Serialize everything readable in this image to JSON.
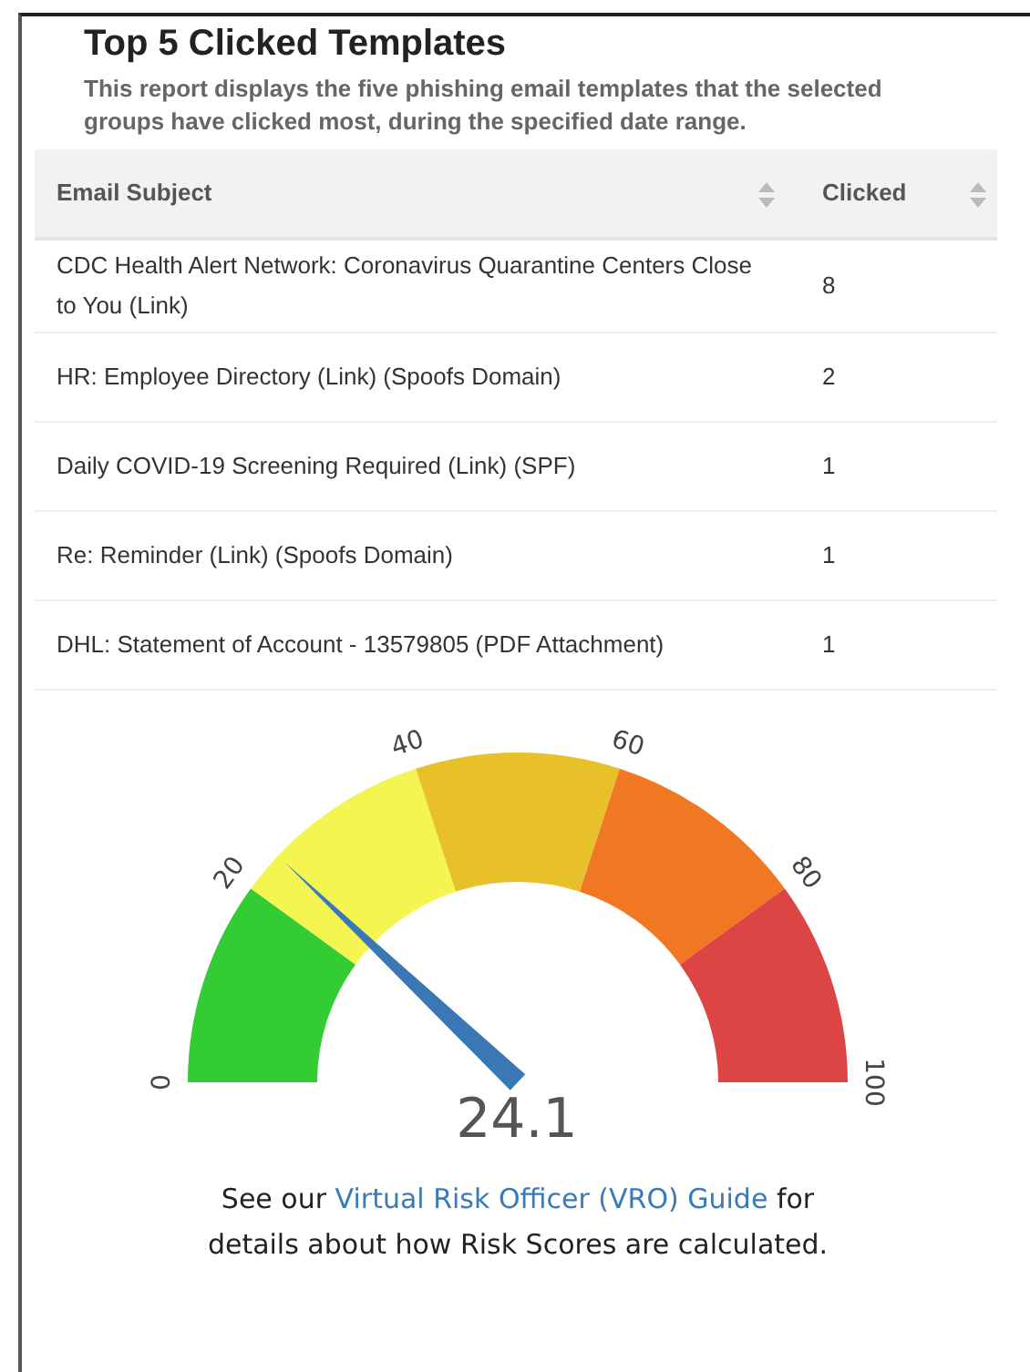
{
  "report": {
    "title": "Top 5 Clicked Templates",
    "description": "This report displays the five phishing email templates that the selected groups have clicked most, during the specified date range."
  },
  "table": {
    "columns": [
      {
        "label": "Email Subject"
      },
      {
        "label": "Clicked"
      }
    ],
    "rows": [
      {
        "subject": "CDC Health Alert Network: Coronavirus Quarantine Centers Close to You (Link)",
        "clicked": "8"
      },
      {
        "subject": "HR: Employee Directory (Link) (Spoofs Domain)",
        "clicked": "2"
      },
      {
        "subject": "Daily COVID-19 Screening Required (Link) (SPF)",
        "clicked": "1"
      },
      {
        "subject": "Re: Reminder (Link) (Spoofs Domain)",
        "clicked": "1"
      },
      {
        "subject": "DHL: Statement of Account - 13579805 (PDF Attachment)",
        "clicked": "1"
      }
    ]
  },
  "gauge": {
    "ticks": [
      "0",
      "20",
      "40",
      "60",
      "80",
      "100"
    ],
    "segments": [
      {
        "color": "#33cc33"
      },
      {
        "color": "#f5f552"
      },
      {
        "color": "#e8c02a"
      },
      {
        "color": "#f07822"
      },
      {
        "color": "#dd4444"
      }
    ],
    "level": 0.241,
    "value": "24.1"
  },
  "footer": {
    "before": "See our",
    "link": "Virtual Risk Officer (VRO) Guide",
    "after": "for details about how Risk Scores are calculated."
  }
}
